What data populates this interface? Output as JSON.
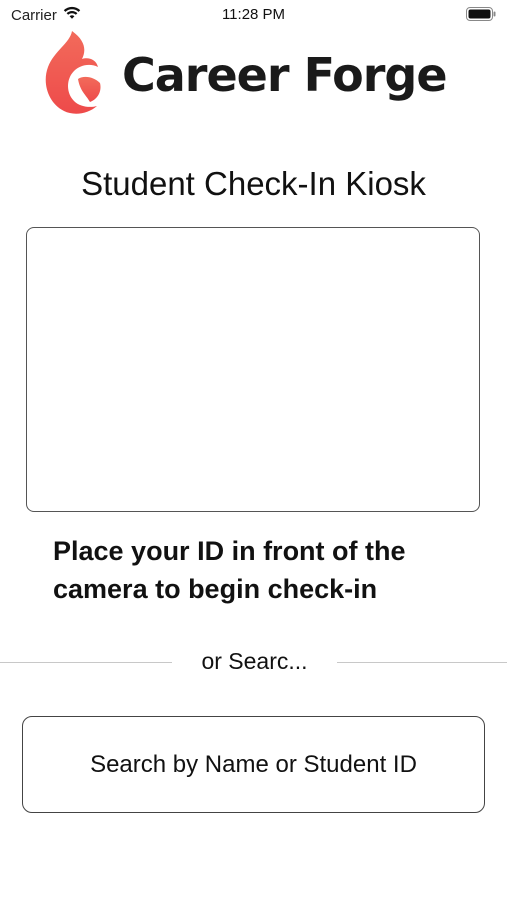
{
  "status_bar": {
    "carrier": "Carrier",
    "time": "11:28 PM",
    "wifi_icon": "wifi-icon",
    "battery_icon": "battery-icon"
  },
  "brand": {
    "name": "Career Forge",
    "logo_icon": "flame-logo-icon",
    "logo_colors": [
      "#f04b4b",
      "#f26b5b"
    ]
  },
  "page": {
    "title": "Student Check-In Kiosk"
  },
  "camera": {
    "instructions": "Place your ID in front of the camera to begin check-in"
  },
  "divider": {
    "label": "or Searc..."
  },
  "search": {
    "button_label": "Search by Name or Student ID"
  }
}
